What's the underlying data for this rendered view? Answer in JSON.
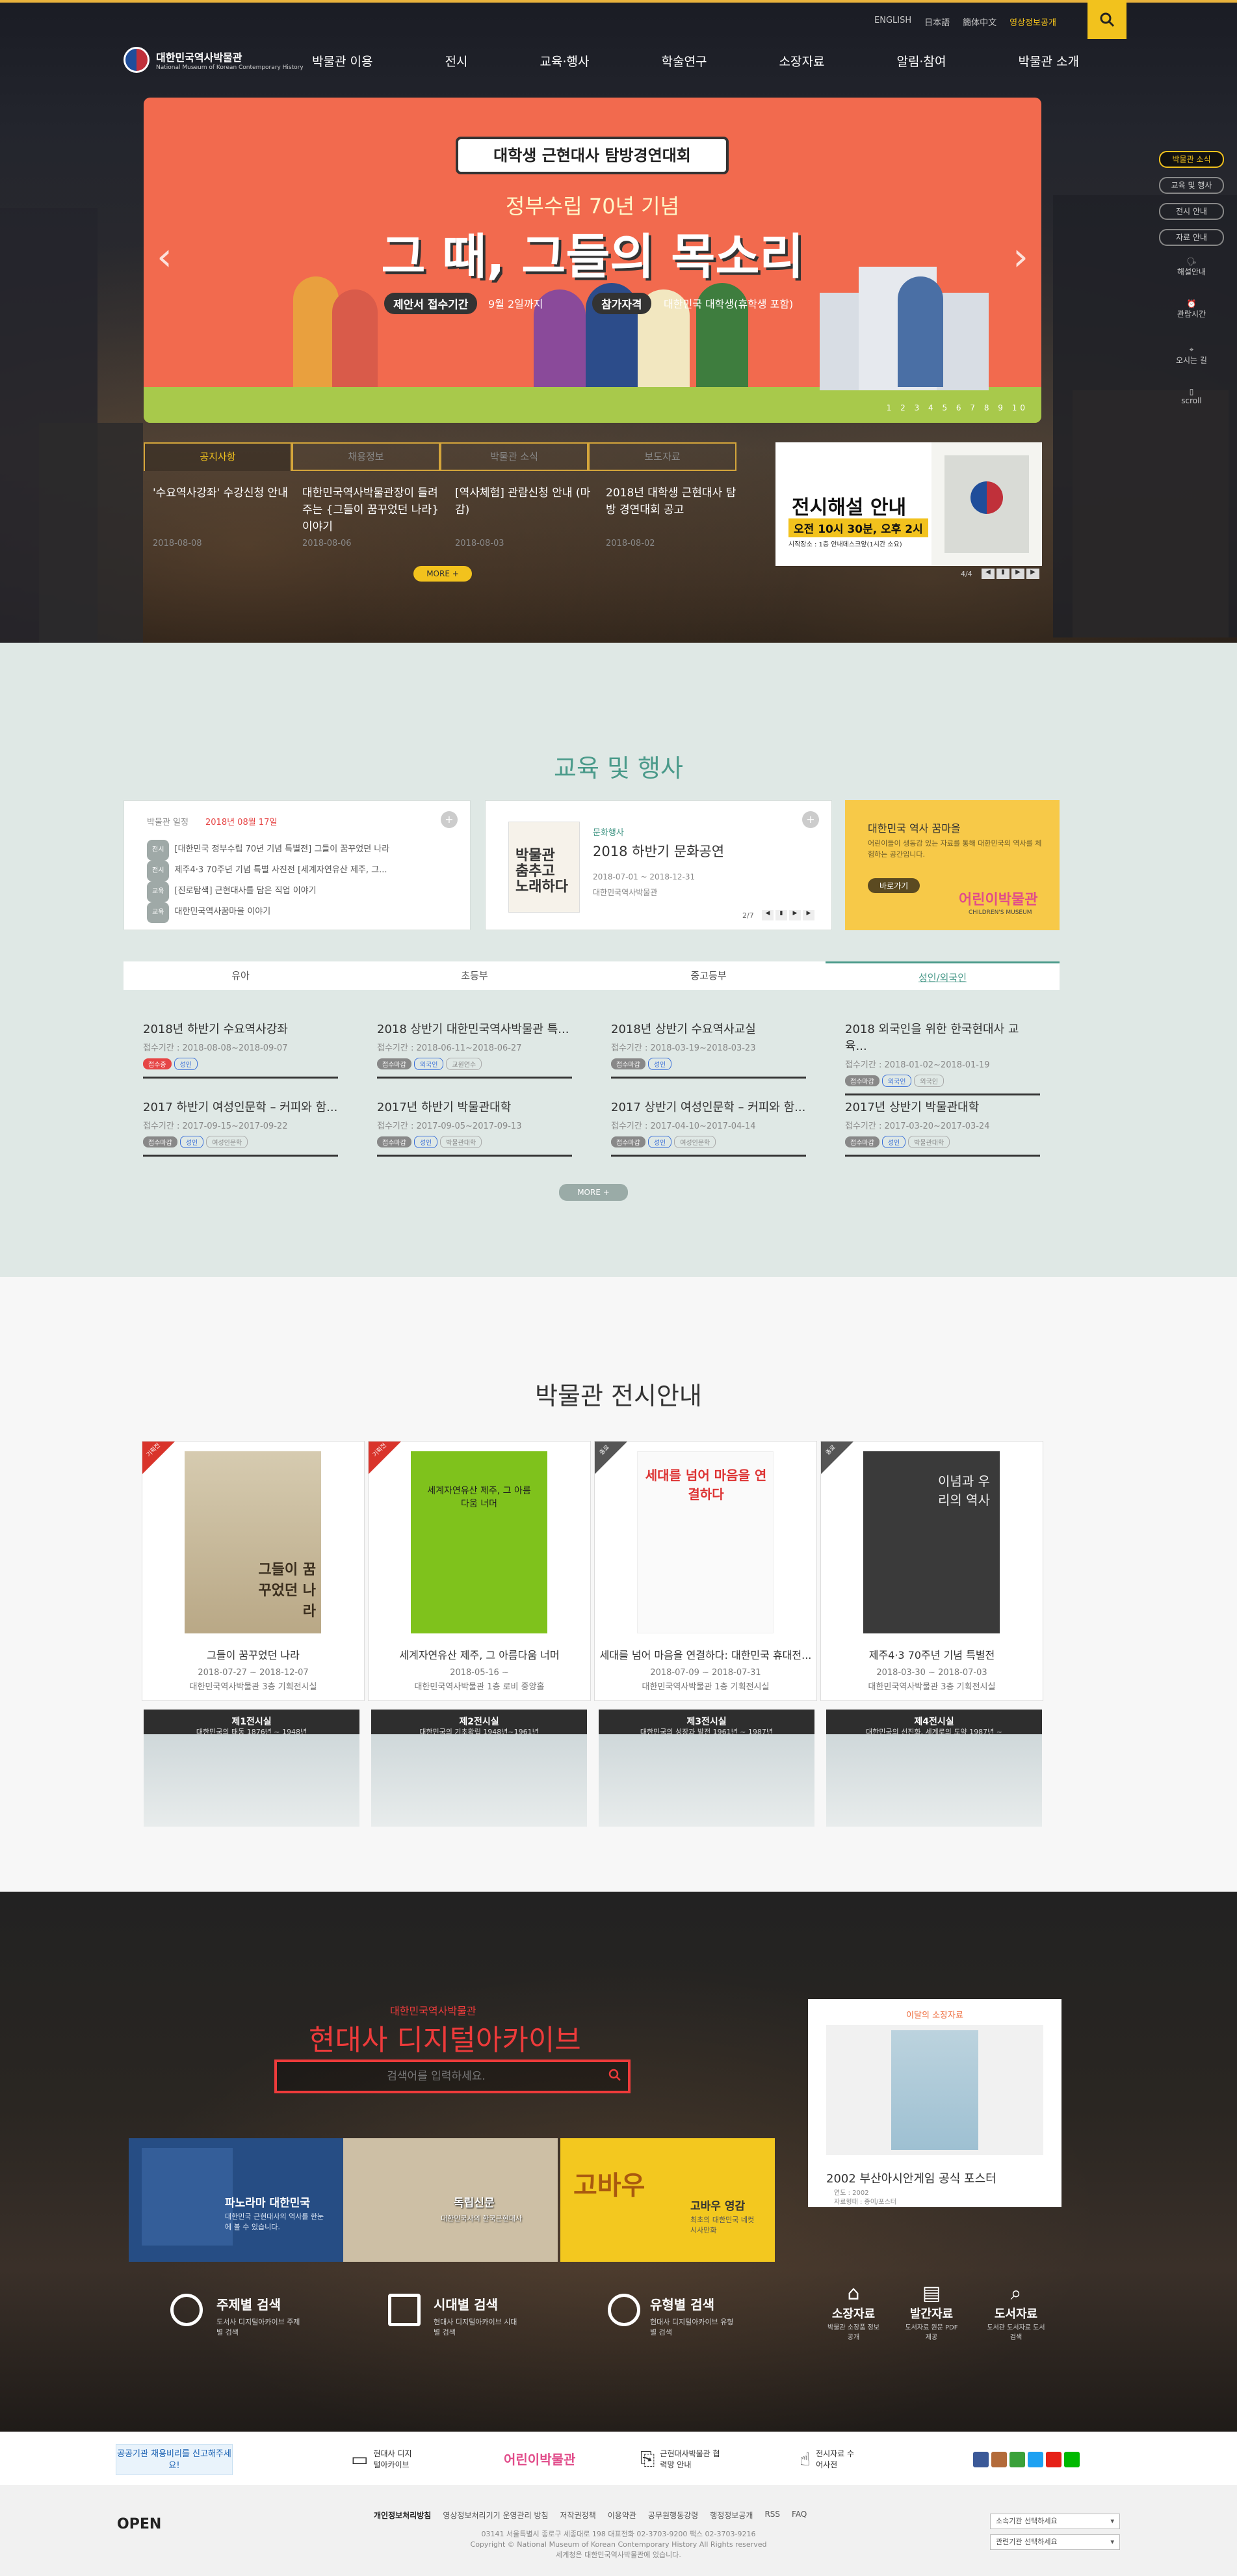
{
  "header": {
    "logo_ko": "대한민국역사박물관",
    "logo_en": "National Museum of Korean Contemporary History",
    "util_links": [
      "ENGLISH",
      "日本語",
      "簡体中文",
      "영상정보공개"
    ],
    "gnb": [
      "박물관 이용",
      "전시",
      "교육·행사",
      "학술연구",
      "소장자료",
      "알림·참여",
      "박물관 소개"
    ]
  },
  "banner": {
    "bubble": "대학생 근현대사 탐방경연대회",
    "subtitle": "정부수립 70년 기념",
    "title": "그 때, 그들의 목소리",
    "pill1": "제안서 접수기간",
    "pill1_text": "9월 2일까지",
    "pill2": "참가자격",
    "pill2_text": "대한민국 대학생(휴학생 포함)",
    "pager": "1 2 3 4 5 6 7 8 9 10"
  },
  "notice": {
    "tabs": [
      "공지사항",
      "채용정보",
      "박물관 소식",
      "보도자료"
    ],
    "items": [
      {
        "title": "'수요역사강좌' 수강신청 안내",
        "date": "2018-08-08"
      },
      {
        "title": "대한민국역사박물관장이 들려주는 {그들이 꿈꾸었던 나라} 이야기",
        "date": "2018-08-06"
      },
      {
        "title": "[역사체험] 관람신청 안내 (마감)",
        "date": "2018-08-03"
      },
      {
        "title": "2018년 대학생 근현대사 탐방 경연대회 공고",
        "date": "2018-08-02"
      }
    ],
    "more": "MORE +"
  },
  "exhibit_guide": {
    "title": "전시해설 안내",
    "time": "오전 10시 30분, 오후 2시",
    "place": "시작장소 : 1층 안내데스크앞(1시간 소요)",
    "pager": "4/4"
  },
  "side_menu": [
    "박물관 소식",
    "교육 및 행사",
    "전시 안내",
    "자료 안내",
    "해설안내",
    "관람시간",
    "오시는 길",
    "scroll"
  ],
  "edu": {
    "title": "교육 및 행사",
    "box1": {
      "label": "박물관 일정",
      "date": "2018년 08월 17일",
      "items": [
        {
          "tag": "전시",
          "text": "[대한민국 정부수립 70년 기념 특별전] 그들이 꿈꾸었던 나라"
        },
        {
          "tag": "전시",
          "text": "제주4·3 70주년 기념 특별 사진전 [세계자연유산 제주, 그..."
        },
        {
          "tag": "교육",
          "text": "[진로탐색] 근현대사를 담은 직업 이야기"
        },
        {
          "tag": "교육",
          "text": "대한민국역사꿈마을 이야기"
        }
      ]
    },
    "box2": {
      "label": "문화행사",
      "title": "2018 하반기 문화공연",
      "date": "2018-07-01 ~ 2018-12-31",
      "place": "대한민국역사박물관",
      "poster": "박물관 춤추고 노래하다",
      "pager": "2/7"
    },
    "box3": {
      "title": "대한민국 역사 꿈마을",
      "desc": "어린이들이 생동감 있는 자료를 통해 대한민국의 역사를 체험하는 공간입니다.",
      "btn": "바로가기",
      "logo": "어린이박물관",
      "logo_en": "CHILDREN'S MUSEUM"
    },
    "tabs": [
      "유아",
      "초등부",
      "중고등부",
      "성인/외국인"
    ],
    "courses": [
      {
        "title": "2018년 하반기 수요역사강좌",
        "date": "접수기간 : 2018-08-08~2018-09-07",
        "tags": [
          "접수중",
          "성인"
        ]
      },
      {
        "title": "2018 상반기 대한민국역사박물관 특...",
        "date": "접수기간 : 2018-06-11~2018-06-27",
        "tags": [
          "접수마감",
          "외국인",
          "교원연수"
        ]
      },
      {
        "title": "2018년 상반기 수요역사교실",
        "date": "접수기간 : 2018-03-19~2018-03-23",
        "tags": [
          "접수마감",
          "성인"
        ]
      },
      {
        "title": "2018 외국인을 위한 한국현대사 교육...",
        "date": "접수기간 : 2018-01-02~2018-01-19",
        "tags": [
          "접수마감",
          "외국인",
          "외국인"
        ]
      },
      {
        "title": "2017 하반기 여성인문학 – 커피와 함...",
        "date": "접수기간 : 2017-09-15~2017-09-22",
        "tags": [
          "접수마감",
          "성인",
          "여성인문학"
        ]
      },
      {
        "title": "2017년 하반기 박물관대학",
        "date": "접수기간 : 2017-09-05~2017-09-13",
        "tags": [
          "접수마감",
          "성인",
          "박물관대학"
        ]
      },
      {
        "title": "2017 상반기 여성인문학 – 커피와 함...",
        "date": "접수기간 : 2017-04-10~2017-04-14",
        "tags": [
          "접수마감",
          "성인",
          "여성인문학"
        ]
      },
      {
        "title": "2017년 상반기 박물관대학",
        "date": "접수기간 : 2017-03-20~2017-03-24",
        "tags": [
          "접수마감",
          "성인",
          "박물관대학"
        ]
      }
    ],
    "more": "MORE +"
  },
  "exhibitions": {
    "title": "박물관 전시안내",
    "cards": [
      {
        "badge": "기획전",
        "poster_text": "그들이 꿈꾸었던 나라",
        "title": "그들이 꿈꾸었던 나라",
        "period": "2018-07-27 ~ 2018-12-07",
        "place": "대한민국역사박물관 3층 기획전시실"
      },
      {
        "badge": "기획전",
        "poster_text": "세계자연유산 제주, 그 아름다움 너머",
        "title": "세계자연유산 제주, 그 아름다움 너머",
        "period": "2018-05-16 ~",
        "place": "대한민국역사박물관 1층 로비 중앙홀"
      },
      {
        "badge": "종료",
        "poster_text": "세대를 넘어 마음을 연결하다",
        "title": "세대를 넘어 마음을 연결하다: 대한민국 휴대전...",
        "period": "2018-07-09 ~ 2018-07-31",
        "place": "대한민국역사박물관 1층 기획전시실"
      },
      {
        "badge": "종료",
        "poster_text": "이념과 우리의 역사",
        "title": "제주4·3 70주년 기념 특별전",
        "period": "2018-03-30 ~ 2018-07-03",
        "place": "대한민국역사박물관 3층 기획전시실"
      }
    ],
    "halls": [
      {
        "name": "제1전시실",
        "desc": "대한민국의 태동 1876년 ~ 1948년"
      },
      {
        "name": "제2전시실",
        "desc": "대한민국의 기초확립 1948년~1961년"
      },
      {
        "name": "제3전시실",
        "desc": "대한민국의 성장과 발전 1961년 ~ 1987년"
      },
      {
        "name": "제4전시실",
        "desc": "대한민국의 선진화, 세계로의 도약 1987년 ~"
      }
    ]
  },
  "archive": {
    "kicker": "대한민국역사박물관",
    "title": "현대사 디지털아카이브",
    "search_placeholder": "검색어를 입력하세요.",
    "tiles": [
      {
        "title": "파노라마 대한민국",
        "desc": "대한민국 근현대사의 역사를 한눈에 볼 수 있습니다."
      },
      {
        "title": "독립신문",
        "desc": "대한민국사의 한국근현대사"
      },
      {
        "title": "고바우 영감",
        "desc": "최초의 대한민국 네컷 시사만화"
      }
    ],
    "search_types": [
      {
        "title": "주제별 검색",
        "desc": "도서사 디지털아카이브 주제별 검색"
      },
      {
        "title": "시대별 검색",
        "desc": "현대사 디지털아카이브 시대별 검색"
      },
      {
        "title": "유형별 검색",
        "desc": "현대사 디지털아카이브 유형별 검색"
      }
    ],
    "quick": [
      {
        "title": "소장자료",
        "desc": "박물관 소장품 정보 공개"
      },
      {
        "title": "발간자료",
        "desc": "도서자료 원문 PDF제공"
      },
      {
        "title": "도서자료",
        "desc": "도서관 도서자료 도서 검색"
      }
    ],
    "featured": {
      "label": "이달의 소장자료",
      "title": "2002 부산아시안게임 공식 포스터",
      "meta1": "연도 : 2002",
      "meta2": "자료형태 : 종이/포스터",
      "meta3": "규격 : 52.5×76.3/52.4×75.8"
    }
  },
  "footer": {
    "banner_text": "공공기관 채용비리를 신고해주세요!",
    "links": [
      {
        "title": "현대사 디지털아카이브"
      },
      {
        "title": "어린이박물관"
      },
      {
        "title": "근현대사박물관 협력망 안내"
      },
      {
        "title": "전시자료 수어사전"
      }
    ],
    "nav": [
      "개인정보처리방침",
      "영상정보처리기기 운영관리 방침",
      "저작권정책",
      "이용약관",
      "공무원행동강령",
      "행정정보공개",
      "RSS",
      "FAQ"
    ],
    "addr": "03141 서울특별시 종로구 세종대로 198  대표전화 02-3703-9200  팩스 02-3703-9216",
    "copy": "Copyright © National Museum of Korean Contemporary History All Rights reserved",
    "copy2": "세계청은 대한민국역사박물관에 있습니다.",
    "open_logo": "OPEN",
    "select1": "소속기관 선택하세요",
    "select2": "관련기관 선택하세요"
  }
}
